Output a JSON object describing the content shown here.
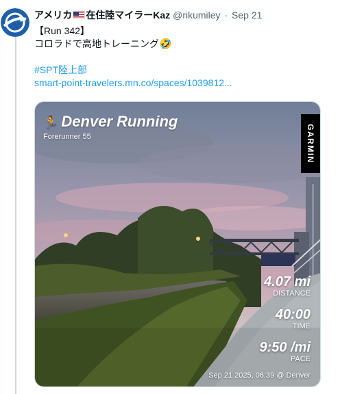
{
  "tweet": {
    "display_name": "アメリカ",
    "display_name_suffix": "在住陸マイラーKaz",
    "flag_icon": "us-flag-icon",
    "handle": "@rikumiley",
    "separator": "·",
    "date": "Sep 21",
    "line1": "【Run 342】",
    "line2": "コロラドで高地トレーニング",
    "emoji": "🤣",
    "hashtag": "#SPT陸上部",
    "link": "smart-point-travelers.mn.co/spaces/1039812..."
  },
  "card": {
    "title": "Denver Running",
    "device": "Forerunner 55",
    "brand": "GARMIN",
    "stats": [
      {
        "value": "4.07 mi",
        "label": "DISTANCE"
      },
      {
        "value": "40:00",
        "label": "TIME"
      },
      {
        "value": "9:50 /mi",
        "label": "PACE"
      }
    ],
    "footer": "Sep 21 2025, 06:39 @ Denver"
  },
  "colors": {
    "link": "#1d9bf0",
    "muted": "#536471",
    "thread": "#cfd9de"
  }
}
